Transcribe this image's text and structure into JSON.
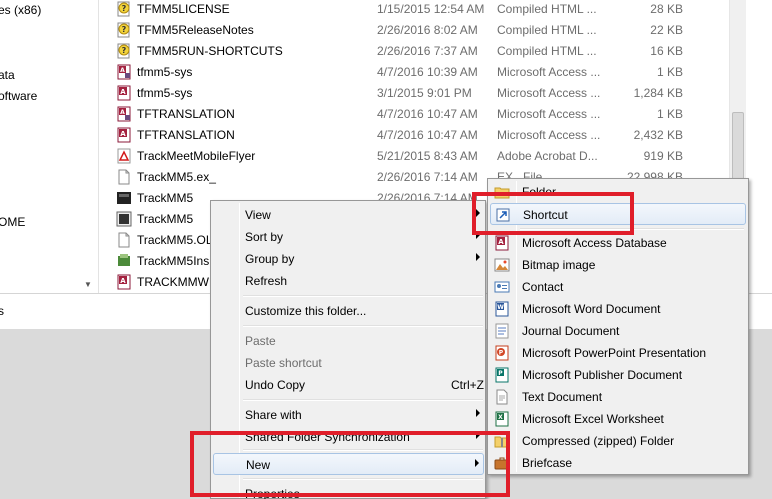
{
  "nav": {
    "items": [
      "es (x86)",
      "ata",
      "oftware",
      "OME"
    ]
  },
  "files": [
    {
      "name": "TFMM5LICENSE",
      "date": "1/15/2015 12:54 AM",
      "type": "Compiled HTML ...",
      "size": "28 KB",
      "icon": "chm-help-icon"
    },
    {
      "name": "TFMM5ReleaseNotes",
      "date": "2/26/2016 8:02 AM",
      "type": "Compiled HTML ...",
      "size": "22 KB",
      "icon": "chm-help-icon"
    },
    {
      "name": "TFMM5RUN-SHORTCUTS",
      "date": "2/26/2016 7:37 AM",
      "type": "Compiled HTML ...",
      "size": "16 KB",
      "icon": "chm-help-icon"
    },
    {
      "name": "tfmm5-sys",
      "date": "4/7/2016 10:39 AM",
      "type": "Microsoft Access ...",
      "size": "1 KB",
      "icon": "access-lock-icon"
    },
    {
      "name": "tfmm5-sys",
      "date": "3/1/2015 9:01 PM",
      "type": "Microsoft Access ...",
      "size": "1,284 KB",
      "icon": "access-db-icon"
    },
    {
      "name": "TFTRANSLATION",
      "date": "4/7/2016 10:47 AM",
      "type": "Microsoft Access ...",
      "size": "1 KB",
      "icon": "access-lock-icon"
    },
    {
      "name": "TFTRANSLATION",
      "date": "4/7/2016 10:47 AM",
      "type": "Microsoft Access ...",
      "size": "2,432 KB",
      "icon": "access-db-icon"
    },
    {
      "name": "TrackMeetMobileFlyer",
      "date": "5/21/2015 8:43 AM",
      "type": "Adobe Acrobat D...",
      "size": "919 KB",
      "icon": "pdf-icon"
    },
    {
      "name": "TrackMM5.ex_",
      "date": "2/26/2016 7:14 AM",
      "type": "EX_ File",
      "size": "22,998 KB",
      "icon": "blank-file-icon"
    },
    {
      "name": "TrackMM5",
      "date": "2/26/2016 7:14 AM",
      "type": "",
      "size": "",
      "icon": "trackmm-app-icon"
    },
    {
      "name": "TrackMM5",
      "date": "",
      "type": "",
      "size": "",
      "icon": "trackmm-app2-icon"
    },
    {
      "name": "TrackMM5.OL",
      "date": "",
      "type": "",
      "size": "",
      "icon": "blank-file-icon"
    },
    {
      "name": "TrackMM5Ins",
      "date": "",
      "type": "",
      "size": "",
      "icon": "installer-icon"
    },
    {
      "name": "TRACKMMWE",
      "date": "",
      "type": "",
      "size": "",
      "icon": "access-db-icon"
    }
  ],
  "status": {
    "text": "s"
  },
  "context_menu": {
    "items": [
      {
        "label": "View",
        "submenu": true
      },
      {
        "label": "Sort by",
        "submenu": true
      },
      {
        "label": "Group by",
        "submenu": true
      },
      {
        "label": "Refresh"
      },
      {
        "label": "Customize this folder..."
      },
      {
        "label": "Paste",
        "disabled": true
      },
      {
        "label": "Paste shortcut",
        "disabled": true
      },
      {
        "label": "Undo Copy",
        "shortcut": "Ctrl+Z"
      },
      {
        "label": "Share with",
        "submenu": true
      },
      {
        "label": "Shared Folder Synchronization",
        "submenu": true
      },
      {
        "label": "New",
        "submenu": true
      },
      {
        "label": "Properties"
      }
    ]
  },
  "new_submenu": {
    "items": [
      {
        "label": "Folder",
        "icon": "folder-icon"
      },
      {
        "label": "Shortcut",
        "icon": "shortcut-icon"
      },
      {
        "label": "Microsoft Access Database",
        "icon": "access-db-icon"
      },
      {
        "label": "Bitmap image",
        "icon": "bitmap-icon"
      },
      {
        "label": "Contact",
        "icon": "contact-icon"
      },
      {
        "label": "Microsoft Word Document",
        "icon": "word-doc-icon"
      },
      {
        "label": "Journal Document",
        "icon": "journal-icon"
      },
      {
        "label": "Microsoft PowerPoint Presentation",
        "icon": "powerpoint-icon"
      },
      {
        "label": "Microsoft Publisher Document",
        "icon": "publisher-icon"
      },
      {
        "label": "Text Document",
        "icon": "text-doc-icon"
      },
      {
        "label": "Microsoft Excel Worksheet",
        "icon": "excel-icon"
      },
      {
        "label": "Compressed (zipped) Folder",
        "icon": "zip-folder-icon"
      },
      {
        "label": "Briefcase",
        "icon": "briefcase-icon"
      }
    ]
  },
  "colors": {
    "highlight_border": "#e01e2a",
    "menu_bg": "#f0f0f0",
    "hover_border": "#a8c4e4"
  }
}
